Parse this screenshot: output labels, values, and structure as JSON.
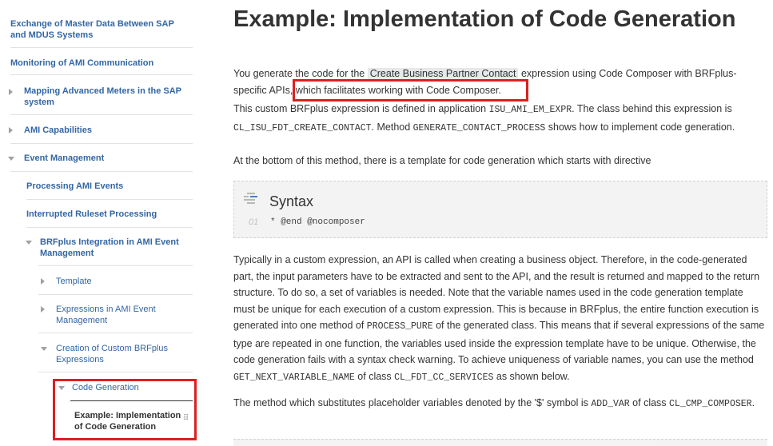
{
  "sidebar": {
    "items": [
      {
        "label": "Exchange of Master Data Between SAP and MDUS Systems"
      },
      {
        "label": "Monitoring of AMI Communication"
      },
      {
        "label": "Mapping Advanced Meters in the SAP system"
      },
      {
        "label": "AMI Capabilities"
      },
      {
        "label": "Event Management"
      },
      {
        "label": "Processing AMI Events"
      },
      {
        "label": "Interrupted Ruleset Processing"
      },
      {
        "label": "BRFplus Integration in AMI Event Management"
      },
      {
        "label": "Template"
      },
      {
        "label": "Expressions in AMI Event Management"
      },
      {
        "label": "Creation of Custom BRFplus Expressions"
      },
      {
        "label": "Code Generation"
      },
      {
        "label": "Example: Implementation of Code Generation"
      }
    ]
  },
  "main": {
    "title": "Example: Implementation of Code Generation",
    "p1": {
      "t1": "You generate the code for the ",
      "ui_term": "Create Business Partner Contact",
      "t2": " expression using Code Composer with BRFplus-specific APIs",
      "t3": ", which facilitates working with Code Composer."
    },
    "p2": {
      "t1": "This custom BRFplus expression is defined in application ",
      "c1": "ISU_AMI_EM_EXPR",
      "t2": ". The class behind this expression is ",
      "c2": "CL_ISU_FDT_CREATE_CONTACT",
      "t3": ". Method ",
      "c3": "GENERATE_CONTACT_PROCESS",
      "t4": " shows how to implement code generation."
    },
    "p3": "At the bottom of this method, there is a template for code generation which starts with directive",
    "syntax": {
      "title": "Syntax",
      "line_no": "01",
      "code": "* @end @nocomposer"
    },
    "p4": {
      "t1": "Typically in a custom expression, an API is called when creating a business object. Therefore, in the code-generated part, the input parameters have to be extracted and sent to the API, and the result is returned and mapped to the return structure. To do so, a set of variables is needed. Note that the variable names used in the code generation template must be unique for each execution of a custom expression. This is because in BRFplus, the entire function execution is generated into one method of ",
      "c1": "PROCESS_PURE",
      "t2": " of the generated class. This means that if several expressions of the same type are repeated in one function, the variables used inside the expression template have to be unique. Otherwise, the code generation fails with a syntax check warning. To achieve uniqueness of variable names, you can use the method ",
      "c2": "GET_NEXT_VARIABLE_NAME",
      "t3": " of class ",
      "c3": "CL_FDT_CC_SERVICES",
      "t4": " as shown below."
    },
    "p5": {
      "t1": "The method which substitutes placeholder variables denoted by the '$' symbol is ",
      "c1": "ADD_VAR",
      "t2": " of class ",
      "c2": "CL_CMP_COMPOSER",
      "t3": "."
    }
  },
  "colors": {
    "link": "#3366a3",
    "highlight_border": "#dd1f1f",
    "syntax_bg": "#f3f3f3"
  },
  "icons": [
    "chevron-right-icon",
    "chevron-down-icon",
    "syntax-code-icon",
    "drag-grip-icon"
  ]
}
